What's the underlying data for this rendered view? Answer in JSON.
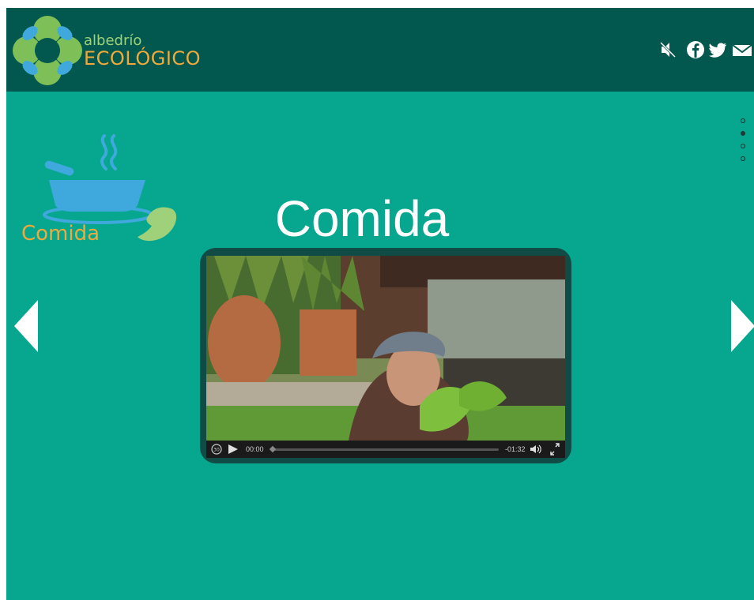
{
  "brand": {
    "line1": "albedrío",
    "line2": "ECOLÓGICO"
  },
  "header_icons": [
    "mute-icon",
    "facebook-icon",
    "twitter-icon",
    "mail-icon"
  ],
  "section": {
    "title": "Comida",
    "category_label": "Comida",
    "dots_total": 4,
    "active_dot": 2
  },
  "video": {
    "current_time": "00:00",
    "remaining_time": "-01:32",
    "progress": 0,
    "buttons": [
      "replay-30-icon",
      "play-icon",
      "volume-icon",
      "fullscreen-icon"
    ]
  },
  "colors": {
    "background": "#07a68f",
    "header": "#02584e",
    "accent_orange": "#f2a93b",
    "accent_green": "#9fd07a",
    "bowl_blue": "#3fa9de"
  }
}
